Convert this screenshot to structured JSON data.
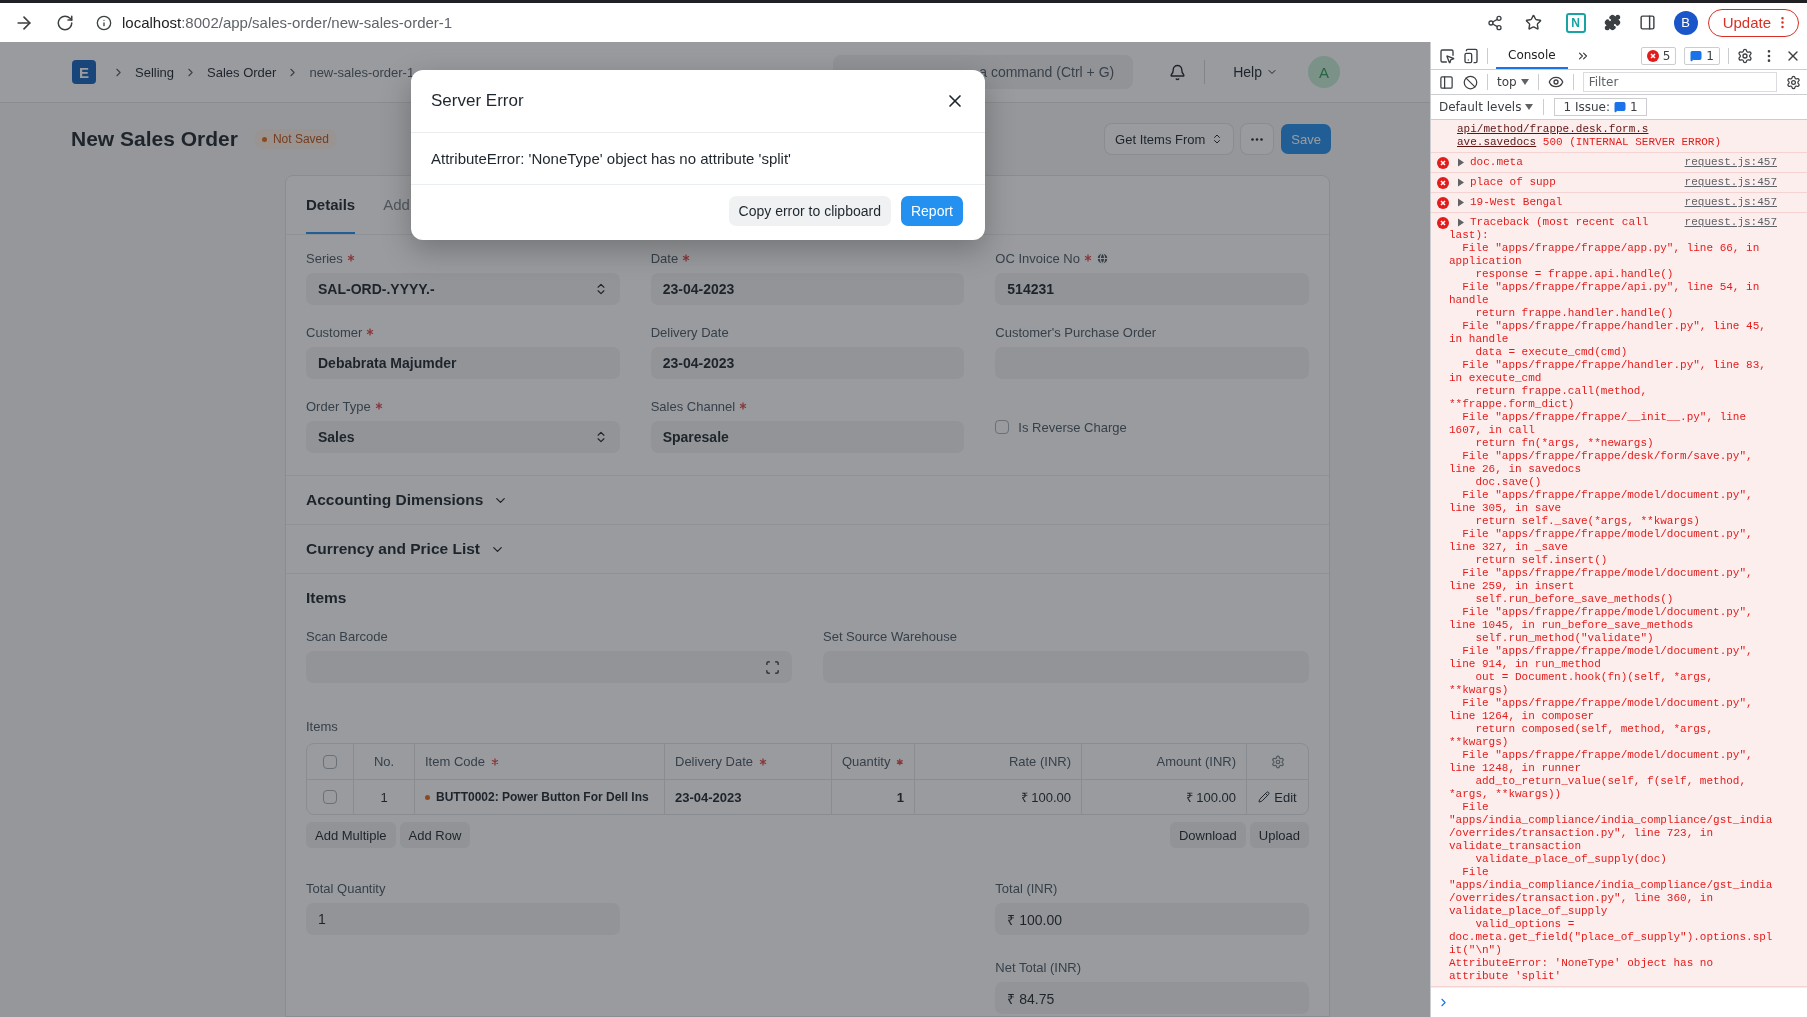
{
  "browser": {
    "url_host": "localhost",
    "url_path": ":8002/app/sales-order/new-sales-order-1",
    "extension": "N",
    "profile": "B",
    "update": "Update"
  },
  "navbar": {
    "logo": "E",
    "breadcrumbs": [
      "Selling",
      "Sales Order",
      "new-sales-order-1"
    ],
    "search_placeholder": "a command (Ctrl + G)",
    "help": "Help",
    "avatar": "A"
  },
  "page": {
    "title": "New Sales Order",
    "status": "Not Saved",
    "buttons": [
      {
        "kind": "dropdown",
        "label": "Get Items From"
      },
      {
        "kind": "more"
      },
      {
        "kind": "primary",
        "label": "Save"
      }
    ]
  },
  "tabs": [
    {
      "label": "Details",
      "selected": true
    },
    {
      "label": "Add",
      "selected": false
    }
  ],
  "fields": [
    {
      "kind": "select",
      "label": "Series",
      "required": true,
      "globe": false,
      "value": "SAL-ORD-.YYYY.-"
    },
    {
      "kind": "input",
      "label": "Date",
      "required": true,
      "globe": false,
      "value": "23-04-2023"
    },
    {
      "kind": "input",
      "label": "OC Invoice No",
      "required": true,
      "globe": true,
      "value": "514231"
    },
    {
      "kind": "input",
      "label": "Customer",
      "required": true,
      "globe": false,
      "value": "Debabrata  Majumder"
    },
    {
      "kind": "input",
      "label": "Delivery Date",
      "required": false,
      "globe": false,
      "value": "23-04-2023"
    },
    {
      "kind": "input",
      "label": "Customer's Purchase Order",
      "required": false,
      "globe": false
    },
    {
      "kind": "select",
      "label": "Order Type",
      "required": true,
      "globe": false,
      "value": "Sales"
    },
    {
      "kind": "input",
      "label": "Sales Channel",
      "required": true,
      "globe": false,
      "value": "Sparesale"
    },
    {
      "kind": "checkbox",
      "label": "Is Reverse Charge",
      "checked": false
    }
  ],
  "sections": [
    {
      "title": "Accounting Dimensions",
      "collapsed": true
    },
    {
      "title": "Currency and Price List",
      "collapsed": true
    }
  ],
  "items": {
    "title": "Items",
    "fields": [
      {
        "kind": "scan",
        "label": "Scan Barcode"
      },
      {
        "kind": "input",
        "label": "Set Source Warehouse"
      }
    ],
    "table_label": "Items",
    "select_all": false,
    "columns": [
      {
        "label": "No.",
        "required": false
      },
      {
        "label": "Item Code",
        "required": true
      },
      {
        "label": "Delivery Date",
        "required": true
      },
      {
        "label": "Quantity",
        "required": true
      },
      {
        "label": "Rate (INR)",
        "required": false
      },
      {
        "label": "Amount (INR)",
        "required": false
      }
    ],
    "rows": [
      {
        "selected": false,
        "no": "1",
        "item_code": "BUTT0002: Power Button For Dell Ins",
        "delivery_date": "23-04-2023",
        "quantity": "1",
        "rate": "₹ 100.00",
        "amount": "₹ 100.00",
        "edit": "Edit"
      }
    ],
    "left_buttons": [
      "Add Multiple",
      "Add Row"
    ],
    "right_buttons": [
      "Download",
      "Upload"
    ]
  },
  "totals": {
    "left": [
      {
        "label": "Total Quantity",
        "value": "1"
      }
    ],
    "right": [
      {
        "label": "Total (INR)",
        "value": "₹ 100.00"
      },
      {
        "label": "Net Total (INR)",
        "value": "₹ 84.75"
      }
    ]
  },
  "modal": {
    "title": "Server Error",
    "message": "AttributeError: 'NoneType' object has no attribute 'split'",
    "buttons": [
      {
        "kind": "secondary",
        "label": "Copy error to clipboard"
      },
      {
        "kind": "primary",
        "label": "Report"
      }
    ]
  },
  "devtools": {
    "tabs": [
      {
        "label": "Console",
        "selected": true
      }
    ],
    "error_count": "5",
    "issue_count": "1",
    "context": "top",
    "filter_placeholder": "Filter",
    "levels": "Default levels",
    "issues_label": "1 Issue:",
    "issues_count": "1",
    "messages": [
      {
        "kind": "network",
        "url_lines": [
          "api/method/frappe.desk.form.s",
          "ave.savedocs"
        ],
        "status": "500 (INTERNAL SERVER ERROR)"
      },
      {
        "kind": "error",
        "expanded": false,
        "source": "request.js:457",
        "lines": [
          "doc.meta"
        ]
      },
      {
        "kind": "error",
        "expanded": false,
        "source": "request.js:457",
        "lines": [
          "place of supp"
        ]
      },
      {
        "kind": "error",
        "expanded": false,
        "source": "request.js:457",
        "lines": [
          "19-West Bengal"
        ]
      },
      {
        "kind": "error",
        "expanded": false,
        "source": "request.js:457",
        "lines": [
          "Traceback (most recent call",
          "last):",
          "  File \"apps/frappe/frappe/app.py\", line 66, in",
          "application",
          "    response = frappe.api.handle()",
          "  File \"apps/frappe/frappe/api.py\", line 54, in",
          "handle",
          "    return frappe.handler.handle()",
          "  File \"apps/frappe/frappe/handler.py\", line 45,",
          "in handle",
          "    data = execute_cmd(cmd)",
          "  File \"apps/frappe/frappe/handler.py\", line 83,",
          "in execute_cmd",
          "    return frappe.call(method,",
          "**frappe.form_dict)",
          "  File \"apps/frappe/frappe/__init__.py\", line",
          "1607, in call",
          "    return fn(*args, **newargs)",
          "  File \"apps/frappe/frappe/desk/form/save.py\",",
          "line 26, in savedocs",
          "    doc.save()",
          "  File \"apps/frappe/frappe/model/document.py\",",
          "line 305, in save",
          "    return self._save(*args, **kwargs)",
          "  File \"apps/frappe/frappe/model/document.py\",",
          "line 327, in _save",
          "    return self.insert()",
          "  File \"apps/frappe/frappe/model/document.py\",",
          "line 259, in insert",
          "    self.run_before_save_methods()",
          "  File \"apps/frappe/frappe/model/document.py\",",
          "line 1045, in run_before_save_methods",
          "    self.run_method(\"validate\")",
          "  File \"apps/frappe/frappe/model/document.py\",",
          "line 914, in run_method",
          "    out = Document.hook(fn)(self, *args,",
          "**kwargs)",
          "  File \"apps/frappe/frappe/model/document.py\",",
          "line 1264, in composer",
          "    return composed(self, method, *args,",
          "**kwargs)",
          "  File \"apps/frappe/frappe/model/document.py\",",
          "line 1248, in runner",
          "    add_to_return_value(self, f(self, method,",
          "*args, **kwargs))",
          "  File",
          "\"apps/india_compliance/india_compliance/gst_india",
          "/overrides/transaction.py\", line 723, in",
          "validate_transaction",
          "    validate_place_of_supply(doc)",
          "  File",
          "\"apps/india_compliance/india_compliance/gst_india",
          "/overrides/transaction.py\", line 360, in",
          "validate_place_of_supply",
          "    valid_options =",
          "doc.meta.get_field(\"place_of_supply\").options.spl",
          "it(\"\\n\")",
          "AttributeError: 'NoneType' object has no",
          "attribute 'split'"
        ]
      }
    ]
  }
}
